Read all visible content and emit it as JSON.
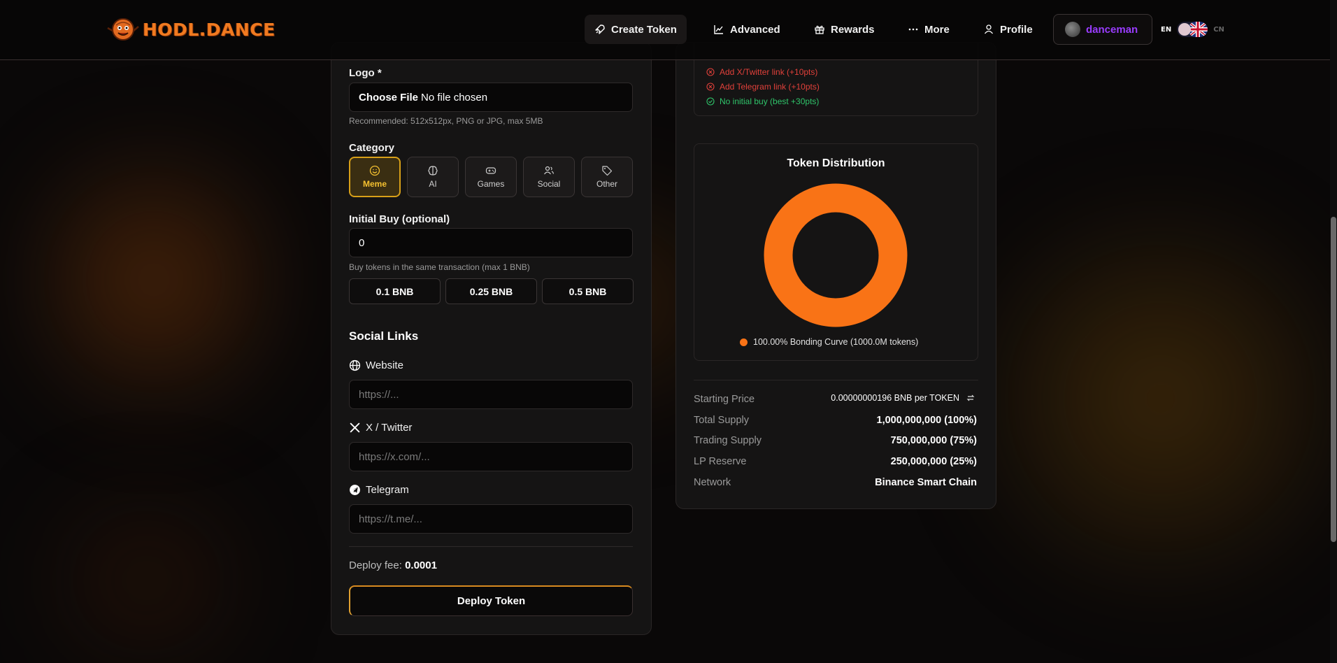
{
  "brand": {
    "name": "HODL.DANCE"
  },
  "nav": {
    "create_token": "Create Token",
    "advanced": "Advanced",
    "rewards": "Rewards",
    "more": "More",
    "profile": "Profile",
    "username": "danceman",
    "lang_en": "EN",
    "lang_cn": "CN"
  },
  "form": {
    "logo_label": "Logo *",
    "file_button": "Choose File",
    "file_status": "No file chosen",
    "logo_hint": "Recommended: 512x512px, PNG or JPG, max 5MB",
    "category_label": "Category",
    "categories": [
      {
        "label": "Meme",
        "icon": "smile-icon",
        "selected": true
      },
      {
        "label": "AI",
        "icon": "brain-icon",
        "selected": false
      },
      {
        "label": "Games",
        "icon": "gamepad-icon",
        "selected": false
      },
      {
        "label": "Social",
        "icon": "users-icon",
        "selected": false
      },
      {
        "label": "Other",
        "icon": "tag-icon",
        "selected": false
      }
    ],
    "initial_buy_label": "Initial Buy (optional)",
    "initial_buy_value": "0",
    "initial_buy_hint": "Buy tokens in the same transaction (max 1 BNB)",
    "quick_buys": [
      "0.1 BNB",
      "0.25 BNB",
      "0.5 BNB"
    ],
    "social_heading": "Social Links",
    "website_label": "Website",
    "website_placeholder": "https://...",
    "twitter_label": "X / Twitter",
    "twitter_placeholder": "https://x.com/...",
    "telegram_label": "Telegram",
    "telegram_placeholder": "https://t.me/...",
    "deploy_fee_label": "Deploy fee:",
    "deploy_fee_value": "0.0001",
    "deploy_button": "Deploy Token"
  },
  "checklist": [
    {
      "text": "Add X/Twitter link (+10pts)",
      "status": "missing"
    },
    {
      "text": "Add Telegram link (+10pts)",
      "status": "missing"
    },
    {
      "text": "No initial buy (best +30pts)",
      "status": "done"
    }
  ],
  "distribution": {
    "title": "Token Distribution",
    "legend": "100.00% Bonding Curve (1000.0M tokens)",
    "segments": [
      {
        "label": "Bonding Curve",
        "percent": 100,
        "color": "#f97316"
      }
    ]
  },
  "info": {
    "starting_price_label": "Starting Price",
    "starting_price_value": "0.00000000196 BNB per TOKEN",
    "total_supply_label": "Total Supply",
    "total_supply_value": "1,000,000,000 (100%)",
    "trading_supply_label": "Trading Supply",
    "trading_supply_value": "750,000,000 (75%)",
    "lp_reserve_label": "LP Reserve",
    "lp_reserve_value": "250,000,000 (25%)",
    "network_label": "Network",
    "network_value": "Binance Smart Chain"
  },
  "colors": {
    "accent": "#f97316",
    "selected": "#d8a018",
    "username": "#9a3cff",
    "error": "#e0403a",
    "success": "#2fc46a"
  }
}
